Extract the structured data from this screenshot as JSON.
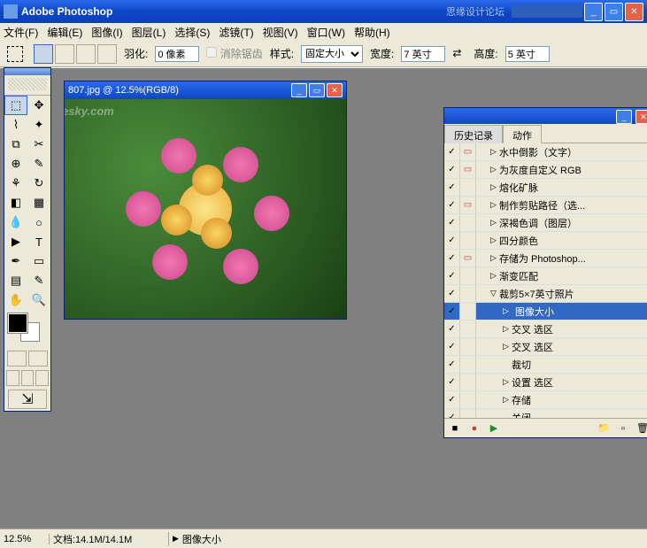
{
  "titlebar": {
    "app_name": "Adobe Photoshop",
    "watermark": "思缘设计论坛"
  },
  "menu": [
    "文件(F)",
    "编辑(E)",
    "图像(I)",
    "图层(L)",
    "选择(S)",
    "滤镜(T)",
    "视图(V)",
    "窗口(W)",
    "帮助(H)"
  ],
  "options": {
    "feather_label": "羽化:",
    "feather_value": "0 像素",
    "antialias": "消除锯齿",
    "style_label": "样式:",
    "style_value": "固定大小",
    "width_label": "宽度:",
    "width_value": "7 英寸",
    "height_label": "高度:",
    "height_value": "5 英寸"
  },
  "document": {
    "title": "807.jpg @ 12.5%(RGB/8)",
    "watermark": "Soft.Yesky.com"
  },
  "panel": {
    "tab1": "历史记录",
    "tab2": "动作",
    "actions": [
      {
        "check": true,
        "dialog": true,
        "indent": 1,
        "expand": false,
        "label": "水中倒影（文字）"
      },
      {
        "check": true,
        "dialog": true,
        "indent": 1,
        "expand": false,
        "label": "为灰度自定义 RGB"
      },
      {
        "check": true,
        "dialog": false,
        "indent": 1,
        "expand": false,
        "label": "熔化矿脉"
      },
      {
        "check": true,
        "dialog": true,
        "indent": 1,
        "expand": false,
        "label": "制作剪贴路径（选..."
      },
      {
        "check": true,
        "dialog": false,
        "indent": 1,
        "expand": false,
        "label": "深褐色调（图层）"
      },
      {
        "check": true,
        "dialog": false,
        "indent": 1,
        "expand": false,
        "label": "四分颜色"
      },
      {
        "check": true,
        "dialog": true,
        "indent": 1,
        "expand": false,
        "label": "存储为 Photoshop..."
      },
      {
        "check": true,
        "dialog": false,
        "indent": 1,
        "expand": false,
        "label": "渐变匹配"
      },
      {
        "check": true,
        "dialog": false,
        "indent": 1,
        "expand": true,
        "label": "裁剪5×7英寸照片"
      },
      {
        "check": true,
        "dialog": false,
        "indent": 2,
        "expand": false,
        "label": "图像大小",
        "hl": true
      },
      {
        "check": true,
        "dialog": false,
        "indent": 2,
        "expand": false,
        "label": "交叉 选区"
      },
      {
        "check": true,
        "dialog": false,
        "indent": 2,
        "expand": false,
        "label": "交叉 选区"
      },
      {
        "check": true,
        "dialog": false,
        "indent": 2,
        "expand": null,
        "label": "裁切"
      },
      {
        "check": true,
        "dialog": false,
        "indent": 2,
        "expand": false,
        "label": "设置 选区"
      },
      {
        "check": true,
        "dialog": false,
        "indent": 2,
        "expand": false,
        "label": "存储"
      },
      {
        "check": true,
        "dialog": false,
        "indent": 2,
        "expand": null,
        "label": "关闭"
      }
    ]
  },
  "status": {
    "zoom": "12.5%",
    "doc": "文档:14.1M/14.1M",
    "info": "图像大小"
  }
}
